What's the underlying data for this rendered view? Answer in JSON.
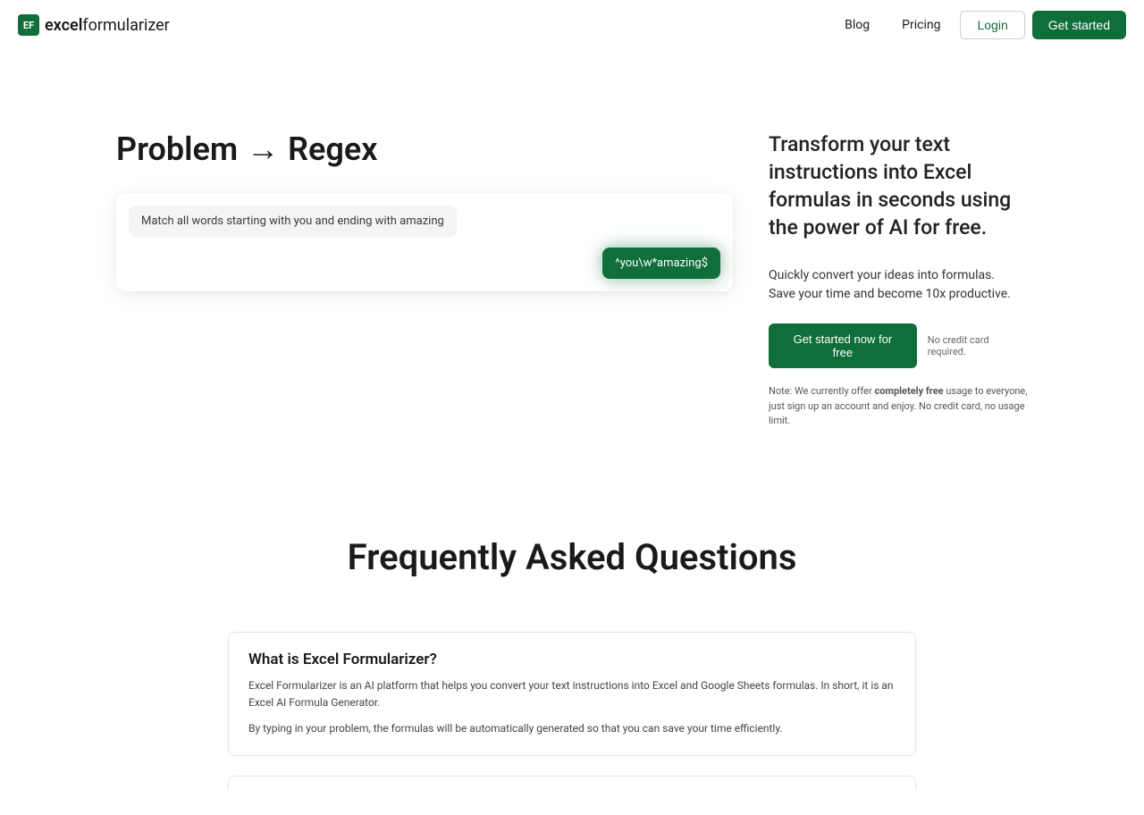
{
  "header": {
    "logo_abbr": "EF",
    "logo_prefix": "excel",
    "logo_suffix": "formularizer",
    "nav": {
      "blog": "Blog",
      "pricing": "Pricing",
      "login": "Login",
      "get_started": "Get started"
    }
  },
  "hero": {
    "title_left": "Problem",
    "title_arrow": "→",
    "title_right": "Regex",
    "chat_input": "Match all words starting with you and ending with amazing",
    "chat_output": "^you\\w*amazing$",
    "headline": "Transform your text instructions into Excel formulas in seconds using the power of AI for free.",
    "subline1": "Quickly convert your ideas into formulas.",
    "subline2": "Save your time and become 10x productive.",
    "cta_button": "Get started now for free",
    "cta_hint": "No credit card required.",
    "note_prefix": "Note: We currently offer ",
    "note_bold": "completely free",
    "note_suffix": " usage to everyone, just sign up an account and enjoy. No credit card, no usage limit."
  },
  "faq": {
    "title": "Frequently Asked Questions",
    "items": [
      {
        "q": "What is Excel Formularizer?",
        "a1": "Excel Formularizer is an AI platform that helps you convert your text instructions into Excel and Google Sheets formulas. In short, it is an Excel AI Formula Generator.",
        "a2": "By typing in your problem, the formulas will be automatically generated so that you can save your time efficiently."
      }
    ]
  }
}
